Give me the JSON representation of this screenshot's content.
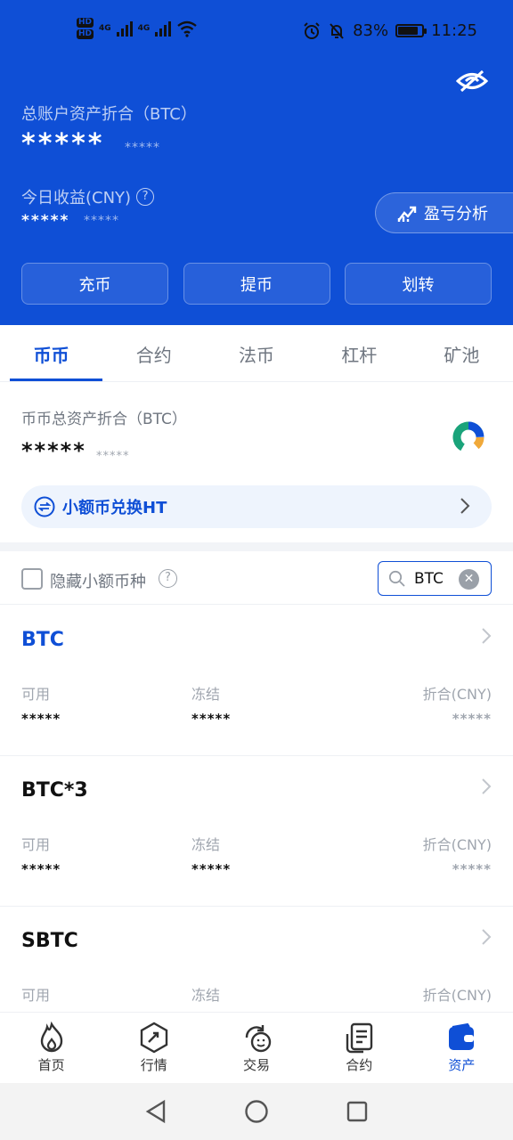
{
  "status_bar": {
    "hd_top": "HD",
    "hd_bottom": "HD",
    "net1": "4G",
    "net2": "4G",
    "battery_percent": "83%",
    "battery_level": 0.83,
    "time": "11:25"
  },
  "header": {
    "total_label": "总账户资产折合（BTC）",
    "total_value": "*****",
    "total_sub": "*****",
    "today_label": "今日收益(CNY)",
    "today_value": "*****",
    "today_sub": "*****",
    "pnl_button": "盈亏分析",
    "actions": [
      "充币",
      "提币",
      "划转"
    ]
  },
  "tabs": [
    "币币",
    "合约",
    "法币",
    "杠杆",
    "矿池"
  ],
  "account": {
    "total_label": "币币总资产折合（BTC）",
    "total_value": "*****",
    "total_sub": "*****",
    "exchange_label": "小额币兑换HT"
  },
  "filter": {
    "hide_small_label": "隐藏小额币种",
    "search_value": "BTC"
  },
  "coins": [
    {
      "name": "BTC",
      "available_label": "可用",
      "frozen_label": "冻结",
      "value_label": "折合(CNY)",
      "available": "*****",
      "frozen": "*****",
      "value": "*****"
    },
    {
      "name": "BTC*3",
      "available_label": "可用",
      "frozen_label": "冻结",
      "value_label": "折合(CNY)",
      "available": "*****",
      "frozen": "*****",
      "value": "*****"
    },
    {
      "name": "SBTC",
      "available_label": "可用",
      "frozen_label": "冻结",
      "value_label": "折合(CNY)"
    }
  ],
  "bottom_nav": [
    {
      "label": "首页",
      "icon": "flame-icon"
    },
    {
      "label": "行情",
      "icon": "market-icon"
    },
    {
      "label": "交易",
      "icon": "trade-icon"
    },
    {
      "label": "合约",
      "icon": "contract-icon"
    },
    {
      "label": "资产",
      "icon": "wallet-icon"
    }
  ],
  "colors": {
    "brand_blue": "#0f4fd6",
    "muted_gray": "#a0a6af"
  }
}
